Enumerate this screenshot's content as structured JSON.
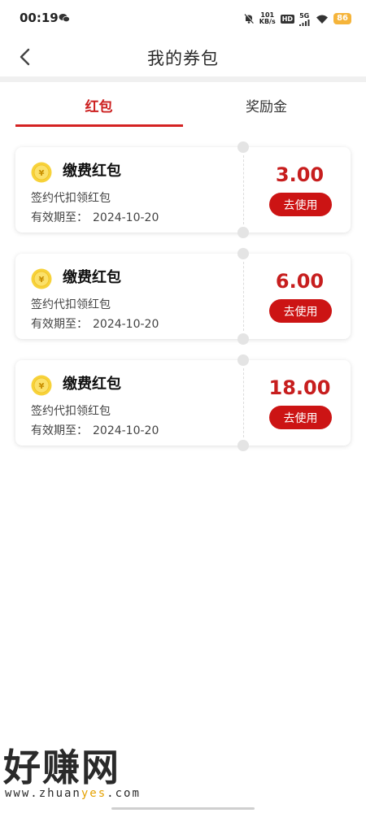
{
  "status_bar": {
    "time": "00:19",
    "speed_value": "101",
    "speed_unit": "KB/s",
    "hd_label": "HD",
    "network_label": "5G",
    "battery": "86"
  },
  "header": {
    "title": "我的券包"
  },
  "tabs": [
    {
      "label": "红包",
      "active": true
    },
    {
      "label": "奖励金",
      "active": false
    }
  ],
  "coupons": [
    {
      "title": "缴费红包",
      "description": "签约代扣领红包",
      "expiry_label": "有效期至：",
      "expiry_date": "2024-10-20",
      "amount": "3.00",
      "button_label": "去使用"
    },
    {
      "title": "缴费红包",
      "description": "签约代扣领红包",
      "expiry_label": "有效期至：",
      "expiry_date": "2024-10-20",
      "amount": "6.00",
      "button_label": "去使用"
    },
    {
      "title": "缴费红包",
      "description": "签约代扣领红包",
      "expiry_label": "有效期至：",
      "expiry_date": "2024-10-20",
      "amount": "18.00",
      "button_label": "去使用"
    }
  ],
  "watermark": {
    "title": "好赚网",
    "url_prefix": "www.zhuan",
    "url_highlight": "yes",
    "url_suffix": ".com"
  },
  "colors": {
    "accent_red": "#cc1414",
    "tab_active": "#cc1f1f",
    "coin_yellow": "#f7d23a",
    "battery": "#f5b43a"
  },
  "icons": {
    "back": "chevron-left-icon",
    "coin": "yuan-coin-icon",
    "wechat": "wechat-icon",
    "mute": "bell-off-icon",
    "wifi": "wifi-icon",
    "signal": "signal-icon"
  }
}
